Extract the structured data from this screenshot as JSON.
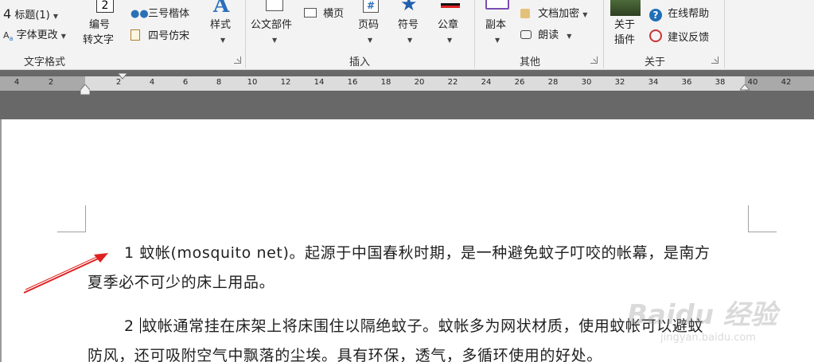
{
  "ribbon": {
    "text_format": {
      "heading_label": "标题(1)",
      "heading_prefix": "4",
      "font_change_label": "字体更改",
      "numbering_line1": "编号",
      "numbering_line2": "转文字",
      "numbering_badge": "2",
      "font_sanhao": "三号楷体",
      "font_sihao": "四号仿宋",
      "style_label": "样式",
      "group_label": "文字格式"
    },
    "insert": {
      "gongwen_label": "公文部件",
      "hengye_label": "横页",
      "page_number_label": "页码",
      "page_number_glyph": "#",
      "symbol_label": "符号",
      "seal_label": "公章",
      "group_label": "插入"
    },
    "other": {
      "copy_label": "副本",
      "encrypt_label": "文档加密",
      "read_label": "朗读",
      "group_label": "其他"
    },
    "about": {
      "about_line1": "关于",
      "about_line2": "插件",
      "help_label": "在线帮助",
      "feedback_label": "建议反馈",
      "group_label": "关于"
    }
  },
  "ruler": {
    "left_labels": [
      "4",
      "2"
    ],
    "labels": [
      "2",
      "4",
      "6",
      "8",
      "10",
      "12",
      "14",
      "16",
      "18",
      "20",
      "22",
      "24",
      "26",
      "28",
      "30",
      "32",
      "34",
      "36",
      "38"
    ],
    "right_labels": [
      "40",
      "42"
    ]
  },
  "document": {
    "para1_line1": "1  蚊帐(mosquito net)。起源于中国春秋时期，是一种避免蚊子叮咬的帐幕，是南方",
    "para1_line2": "夏季必不可少的床上用品。",
    "para2_prefix": "2 ",
    "para2_line1": "蚊帐通常挂在床架上将床围住以隔绝蚊子。蚊帐多为网状材质，使用蚊帐可以避蚊",
    "para2_line2": "防风，还可吸附空气中飘落的尘埃。具有环保，透气，多循环使用的好处。"
  },
  "colors": {
    "arrow": "#e02020",
    "ribbon_bg": "#f3f3f3",
    "ruler_band": "#686868",
    "help_icon": "#1e6fb8"
  },
  "watermark_text": "Baidu 经验",
  "watermark_sub": "jingyan.baidu.com"
}
